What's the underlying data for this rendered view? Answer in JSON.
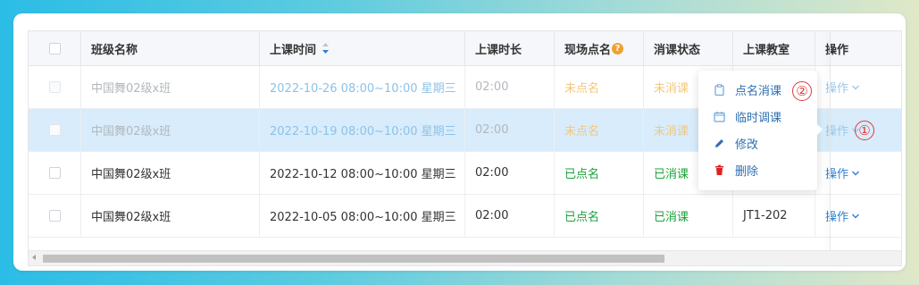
{
  "table": {
    "columns": [
      "",
      "班级名称",
      "上课时间",
      "上课时长",
      "现场点名",
      "消课状态",
      "上课教室",
      "操作"
    ],
    "rows": [
      {
        "class": "中国舞02级x班",
        "time": "2022-10-26 08:00~10:00 星期三",
        "duration": "02:00",
        "rollcall": "未点名",
        "status": "未消课",
        "room": "",
        "action": "操作"
      },
      {
        "class": "中国舞02级x班",
        "time": "2022-10-19 08:00~10:00 星期三",
        "duration": "02:00",
        "rollcall": "未点名",
        "status": "未消课",
        "room": "",
        "action": "操作"
      },
      {
        "class": "中国舞02级x班",
        "time": "2022-10-12 08:00~10:00 星期三",
        "duration": "02:00",
        "rollcall": "已点名",
        "status": "已消课",
        "room": "",
        "action": "操作"
      },
      {
        "class": "中国舞02级x班",
        "time": "2022-10-05 08:00~10:00 星期三",
        "duration": "02:00",
        "rollcall": "已点名",
        "status": "已消课",
        "room": "JT1-202",
        "action": "操作"
      }
    ]
  },
  "dropdown": {
    "items": [
      {
        "label": "点名消课",
        "icon": "clipboard-icon"
      },
      {
        "label": "临时调课",
        "icon": "calendar-icon"
      },
      {
        "label": "修改",
        "icon": "pencil-icon"
      },
      {
        "label": "删除",
        "icon": "trash-icon"
      }
    ]
  },
  "annotations": {
    "one": "①",
    "two": "②"
  },
  "colors": {
    "accent": "#2d7fd3",
    "orange": "#f0a030",
    "green": "#1aa33a",
    "selected_row": "#d8ecfb",
    "annotation": "#e03a3a"
  }
}
